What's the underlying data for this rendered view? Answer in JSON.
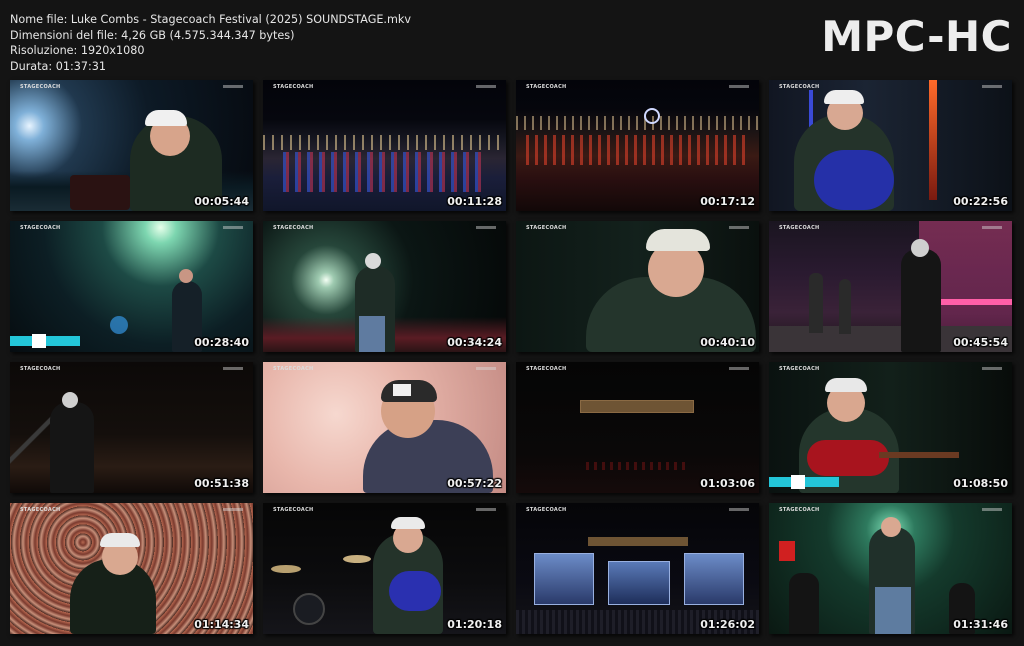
{
  "file_info": {
    "name": "Nome file: Luke Combs - Stagecoach Festival (2025) SOUNDSTAGE.mkv",
    "size": "Dimensioni del file: 4,26 GB (4.575.344.347 bytes)",
    "resolution": "Risoluzione: 1920x1080",
    "duration": "Durata: 01:37:31"
  },
  "logo": "MPC-HC",
  "thumbnails": [
    {
      "timestamp": "00:05:44",
      "stage_logo": "STAGECOACH"
    },
    {
      "timestamp": "00:11:28",
      "stage_logo": "STAGECOACH"
    },
    {
      "timestamp": "00:17:12",
      "stage_logo": "STAGECOACH"
    },
    {
      "timestamp": "00:22:56",
      "stage_logo": "STAGECOACH"
    },
    {
      "timestamp": "00:28:40",
      "stage_logo": "STAGECOACH"
    },
    {
      "timestamp": "00:34:24",
      "stage_logo": "STAGECOACH"
    },
    {
      "timestamp": "00:40:10",
      "stage_logo": "STAGECOACH"
    },
    {
      "timestamp": "00:45:54",
      "stage_logo": "STAGECOACH"
    },
    {
      "timestamp": "00:51:38",
      "stage_logo": "STAGECOACH"
    },
    {
      "timestamp": "00:57:22",
      "stage_logo": "STAGECOACH"
    },
    {
      "timestamp": "01:03:06",
      "stage_logo": "STAGECOACH"
    },
    {
      "timestamp": "01:08:50",
      "stage_logo": "STAGECOACH"
    },
    {
      "timestamp": "01:14:34",
      "stage_logo": "STAGECOACH"
    },
    {
      "timestamp": "01:20:18",
      "stage_logo": "STAGECOACH"
    },
    {
      "timestamp": "01:26:02",
      "stage_logo": "STAGECOACH"
    },
    {
      "timestamp": "01:31:46",
      "stage_logo": "STAGECOACH"
    }
  ]
}
